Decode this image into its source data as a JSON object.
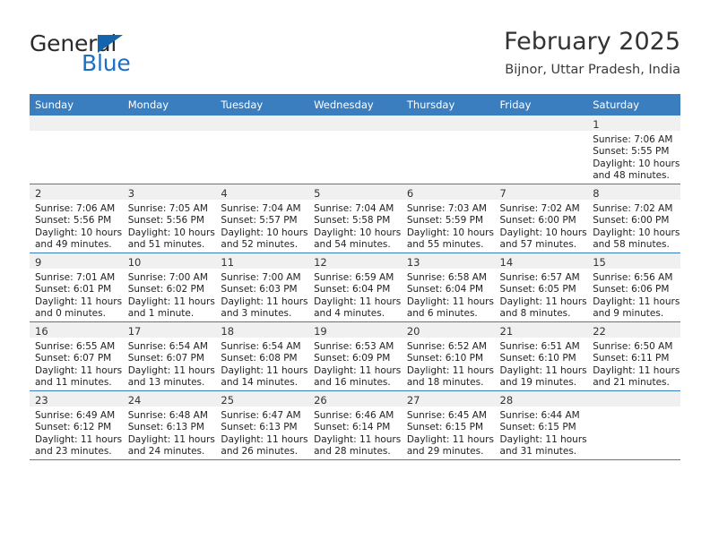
{
  "logo": {
    "primary_text": "General",
    "secondary_text": "Blue",
    "triangle_color": "#1464ac",
    "secondary_color": "#1b6fc4"
  },
  "header": {
    "title": "February 2025",
    "subtitle": "Bijnor, Uttar Pradesh, India"
  },
  "theme": {
    "header_bg": "#3a7ebf",
    "daynum_band": "#f0f0f0",
    "row_border": "#3a7ebf"
  },
  "weekday_headers": [
    "Sunday",
    "Monday",
    "Tuesday",
    "Wednesday",
    "Thursday",
    "Friday",
    "Saturday"
  ],
  "weeks": [
    [
      {
        "day": "",
        "sunrise": "",
        "sunset": "",
        "daylight_1": "",
        "daylight_2": ""
      },
      {
        "day": "",
        "sunrise": "",
        "sunset": "",
        "daylight_1": "",
        "daylight_2": ""
      },
      {
        "day": "",
        "sunrise": "",
        "sunset": "",
        "daylight_1": "",
        "daylight_2": ""
      },
      {
        "day": "",
        "sunrise": "",
        "sunset": "",
        "daylight_1": "",
        "daylight_2": ""
      },
      {
        "day": "",
        "sunrise": "",
        "sunset": "",
        "daylight_1": "",
        "daylight_2": ""
      },
      {
        "day": "",
        "sunrise": "",
        "sunset": "",
        "daylight_1": "",
        "daylight_2": ""
      },
      {
        "day": "1",
        "sunrise": "Sunrise: 7:06 AM",
        "sunset": "Sunset: 5:55 PM",
        "daylight_1": "Daylight: 10 hours",
        "daylight_2": "and 48 minutes."
      }
    ],
    [
      {
        "day": "2",
        "sunrise": "Sunrise: 7:06 AM",
        "sunset": "Sunset: 5:56 PM",
        "daylight_1": "Daylight: 10 hours",
        "daylight_2": "and 49 minutes."
      },
      {
        "day": "3",
        "sunrise": "Sunrise: 7:05 AM",
        "sunset": "Sunset: 5:56 PM",
        "daylight_1": "Daylight: 10 hours",
        "daylight_2": "and 51 minutes."
      },
      {
        "day": "4",
        "sunrise": "Sunrise: 7:04 AM",
        "sunset": "Sunset: 5:57 PM",
        "daylight_1": "Daylight: 10 hours",
        "daylight_2": "and 52 minutes."
      },
      {
        "day": "5",
        "sunrise": "Sunrise: 7:04 AM",
        "sunset": "Sunset: 5:58 PM",
        "daylight_1": "Daylight: 10 hours",
        "daylight_2": "and 54 minutes."
      },
      {
        "day": "6",
        "sunrise": "Sunrise: 7:03 AM",
        "sunset": "Sunset: 5:59 PM",
        "daylight_1": "Daylight: 10 hours",
        "daylight_2": "and 55 minutes."
      },
      {
        "day": "7",
        "sunrise": "Sunrise: 7:02 AM",
        "sunset": "Sunset: 6:00 PM",
        "daylight_1": "Daylight: 10 hours",
        "daylight_2": "and 57 minutes."
      },
      {
        "day": "8",
        "sunrise": "Sunrise: 7:02 AM",
        "sunset": "Sunset: 6:00 PM",
        "daylight_1": "Daylight: 10 hours",
        "daylight_2": "and 58 minutes."
      }
    ],
    [
      {
        "day": "9",
        "sunrise": "Sunrise: 7:01 AM",
        "sunset": "Sunset: 6:01 PM",
        "daylight_1": "Daylight: 11 hours",
        "daylight_2": "and 0 minutes."
      },
      {
        "day": "10",
        "sunrise": "Sunrise: 7:00 AM",
        "sunset": "Sunset: 6:02 PM",
        "daylight_1": "Daylight: 11 hours",
        "daylight_2": "and 1 minute."
      },
      {
        "day": "11",
        "sunrise": "Sunrise: 7:00 AM",
        "sunset": "Sunset: 6:03 PM",
        "daylight_1": "Daylight: 11 hours",
        "daylight_2": "and 3 minutes."
      },
      {
        "day": "12",
        "sunrise": "Sunrise: 6:59 AM",
        "sunset": "Sunset: 6:04 PM",
        "daylight_1": "Daylight: 11 hours",
        "daylight_2": "and 4 minutes."
      },
      {
        "day": "13",
        "sunrise": "Sunrise: 6:58 AM",
        "sunset": "Sunset: 6:04 PM",
        "daylight_1": "Daylight: 11 hours",
        "daylight_2": "and 6 minutes."
      },
      {
        "day": "14",
        "sunrise": "Sunrise: 6:57 AM",
        "sunset": "Sunset: 6:05 PM",
        "daylight_1": "Daylight: 11 hours",
        "daylight_2": "and 8 minutes."
      },
      {
        "day": "15",
        "sunrise": "Sunrise: 6:56 AM",
        "sunset": "Sunset: 6:06 PM",
        "daylight_1": "Daylight: 11 hours",
        "daylight_2": "and 9 minutes."
      }
    ],
    [
      {
        "day": "16",
        "sunrise": "Sunrise: 6:55 AM",
        "sunset": "Sunset: 6:07 PM",
        "daylight_1": "Daylight: 11 hours",
        "daylight_2": "and 11 minutes."
      },
      {
        "day": "17",
        "sunrise": "Sunrise: 6:54 AM",
        "sunset": "Sunset: 6:07 PM",
        "daylight_1": "Daylight: 11 hours",
        "daylight_2": "and 13 minutes."
      },
      {
        "day": "18",
        "sunrise": "Sunrise: 6:54 AM",
        "sunset": "Sunset: 6:08 PM",
        "daylight_1": "Daylight: 11 hours",
        "daylight_2": "and 14 minutes."
      },
      {
        "day": "19",
        "sunrise": "Sunrise: 6:53 AM",
        "sunset": "Sunset: 6:09 PM",
        "daylight_1": "Daylight: 11 hours",
        "daylight_2": "and 16 minutes."
      },
      {
        "day": "20",
        "sunrise": "Sunrise: 6:52 AM",
        "sunset": "Sunset: 6:10 PM",
        "daylight_1": "Daylight: 11 hours",
        "daylight_2": "and 18 minutes."
      },
      {
        "day": "21",
        "sunrise": "Sunrise: 6:51 AM",
        "sunset": "Sunset: 6:10 PM",
        "daylight_1": "Daylight: 11 hours",
        "daylight_2": "and 19 minutes."
      },
      {
        "day": "22",
        "sunrise": "Sunrise: 6:50 AM",
        "sunset": "Sunset: 6:11 PM",
        "daylight_1": "Daylight: 11 hours",
        "daylight_2": "and 21 minutes."
      }
    ],
    [
      {
        "day": "23",
        "sunrise": "Sunrise: 6:49 AM",
        "sunset": "Sunset: 6:12 PM",
        "daylight_1": "Daylight: 11 hours",
        "daylight_2": "and 23 minutes."
      },
      {
        "day": "24",
        "sunrise": "Sunrise: 6:48 AM",
        "sunset": "Sunset: 6:13 PM",
        "daylight_1": "Daylight: 11 hours",
        "daylight_2": "and 24 minutes."
      },
      {
        "day": "25",
        "sunrise": "Sunrise: 6:47 AM",
        "sunset": "Sunset: 6:13 PM",
        "daylight_1": "Daylight: 11 hours",
        "daylight_2": "and 26 minutes."
      },
      {
        "day": "26",
        "sunrise": "Sunrise: 6:46 AM",
        "sunset": "Sunset: 6:14 PM",
        "daylight_1": "Daylight: 11 hours",
        "daylight_2": "and 28 minutes."
      },
      {
        "day": "27",
        "sunrise": "Sunrise: 6:45 AM",
        "sunset": "Sunset: 6:15 PM",
        "daylight_1": "Daylight: 11 hours",
        "daylight_2": "and 29 minutes."
      },
      {
        "day": "28",
        "sunrise": "Sunrise: 6:44 AM",
        "sunset": "Sunset: 6:15 PM",
        "daylight_1": "Daylight: 11 hours",
        "daylight_2": "and 31 minutes."
      },
      {
        "day": "",
        "sunrise": "",
        "sunset": "",
        "daylight_1": "",
        "daylight_2": ""
      }
    ]
  ]
}
